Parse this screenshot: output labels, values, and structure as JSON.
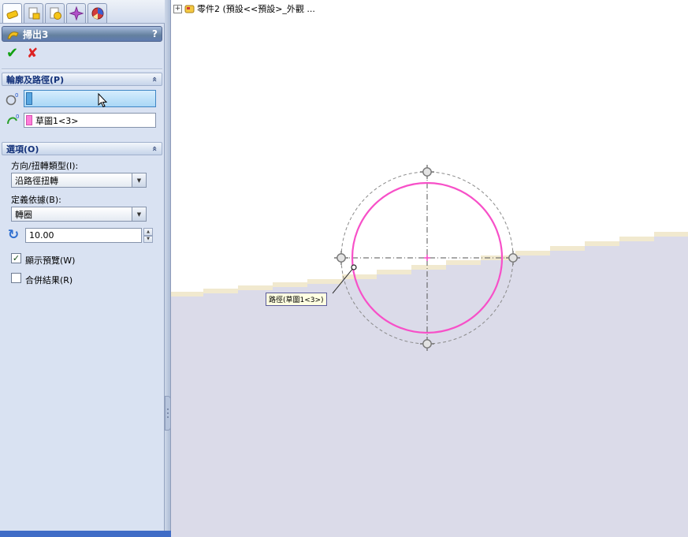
{
  "tabs": [
    {
      "id": "property-manager",
      "selected": true
    },
    {
      "id": "configuration-manager",
      "selected": false
    },
    {
      "id": "property-tab-3",
      "selected": false
    },
    {
      "id": "dimxpert-manager",
      "selected": false
    },
    {
      "id": "display-manager",
      "selected": false
    }
  ],
  "panel": {
    "title": "掃出3",
    "help": "?",
    "profile_path": {
      "title": "輪廓及路徑(P)",
      "profile_value": "",
      "path_value": "草圖1<3>"
    },
    "options": {
      "title": "選項(O)",
      "orientation_label": "方向/扭轉類型(I):",
      "orientation_value": "沿路徑扭轉",
      "define_label": "定義依據(B):",
      "define_value": "轉圈",
      "turns_value": "10.00",
      "show_preview_label": "顯示預覽(W)",
      "show_preview_checked": true,
      "merge_result_label": "合併結果(R)",
      "merge_result_checked": false
    }
  },
  "graphics": {
    "tree_item": "零件2 (預設<<預設>_外觀 ...",
    "callout": "路徑(草圖1<3>)",
    "colors": {
      "path_circle": "#f750c8",
      "background_lower": "#dbdbe9",
      "edge_band": "#f1e9cf",
      "selection_blue": "#58a6e0",
      "path_chip_pink": "#ff7ed9",
      "panel_bottom_bar": "#3f6cc6"
    }
  },
  "icons": {
    "ok": "✔",
    "cancel": "✘",
    "collapse": "«",
    "dropdown": "▼",
    "spin_up": "▲",
    "spin_down": "▼",
    "check": "✓",
    "expand": "+",
    "revolve": "↻"
  }
}
